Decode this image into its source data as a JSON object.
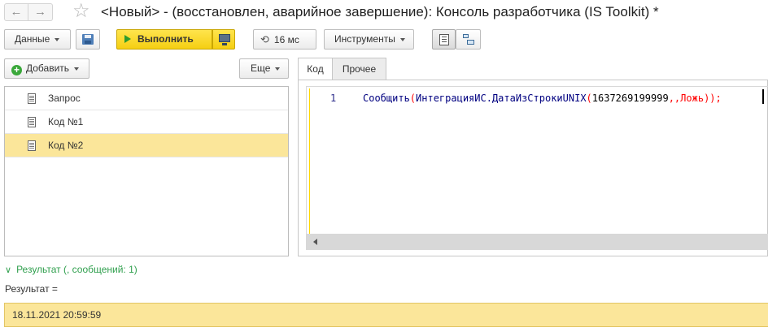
{
  "window": {
    "title": "<Новый> - (восстановлен, аварийное завершение): Консоль разработчика (IS Toolkit) *"
  },
  "nav": {
    "back_icon": "←",
    "forward_icon": "→",
    "favorite_icon": "☆"
  },
  "toolbar": {
    "data_label": "Данные",
    "run_label": "Выполнить",
    "timer_label": "16 мс",
    "tools_label": "Инструменты"
  },
  "list_panel": {
    "add_label": "Добавить",
    "more_label": "Еще",
    "items": [
      {
        "label": "Запрос",
        "selected": false
      },
      {
        "label": "Код №1",
        "selected": false
      },
      {
        "label": "Код №2",
        "selected": true
      }
    ]
  },
  "tabs": [
    {
      "label": "Код",
      "active": true
    },
    {
      "label": "Прочее",
      "active": false
    }
  ],
  "editor": {
    "line_number": "1",
    "code_func": "Сообщить",
    "code_open1": "(",
    "code_call": "ИнтеграцияИС.ДатаИзСтрокиUNIX",
    "code_open2": "(",
    "code_arg": "1637269199999",
    "code_commas": ",,",
    "code_bool": "Ложь",
    "code_close": "));"
  },
  "result": {
    "header": "Результат (, сообщений: 1)",
    "label": "Результат =",
    "value": "18.11.2021 20:59:59"
  },
  "colors": {
    "run_button": "#f5cf12",
    "selection": "#fbe69a",
    "result_header": "#2f9f4d"
  }
}
